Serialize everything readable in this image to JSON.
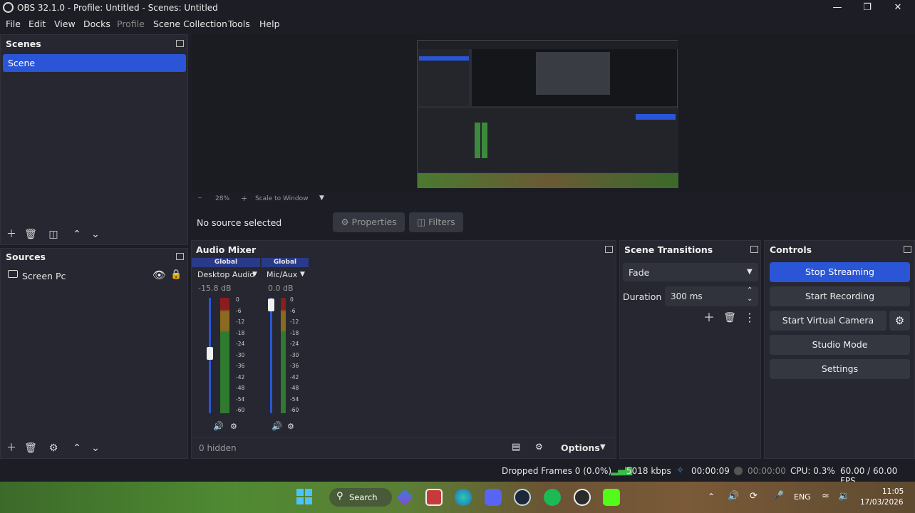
{
  "window": {
    "title": "OBS 32.1.0 - Profile: Untitled - Scenes: Untitled"
  },
  "menu": [
    "File",
    "Edit",
    "View",
    "Docks",
    "Profile",
    "Scene Collection",
    "Tools",
    "Help"
  ],
  "scenes": {
    "title": "Scenes",
    "items": [
      "Scene"
    ]
  },
  "preview": {
    "zoom": "28%",
    "scale_mode": "Scale to Window"
  },
  "source_bar": {
    "status": "No source selected",
    "properties": "Properties",
    "filters": "Filters"
  },
  "sources": {
    "title": "Sources",
    "items": [
      "Screen Pc"
    ]
  },
  "audio_mixer": {
    "title": "Audio Mixer",
    "channels": [
      {
        "badge": "Global",
        "name": "Desktop Audio",
        "db": "-15.8 dB",
        "fader": 0.55,
        "level": 0.95
      },
      {
        "badge": "Global",
        "name": "Mic/Aux",
        "db": "0.0 dB",
        "fader": 0.95,
        "level": 0.95
      }
    ],
    "scale": [
      "0",
      "-6",
      "-12",
      "-18",
      "-24",
      "-30",
      "-36",
      "-42",
      "-48",
      "-54",
      "-60"
    ],
    "hidden": "0 hidden",
    "options": "Options"
  },
  "scene_transitions": {
    "title": "Scene Transitions",
    "type": "Fade",
    "duration_label": "Duration",
    "duration_value": "300 ms"
  },
  "controls": {
    "title": "Controls",
    "stop_streaming": "Stop Streaming",
    "start_recording": "Start Recording",
    "start_virtual_camera": "Start Virtual Camera",
    "studio_mode": "Studio Mode",
    "settings": "Settings"
  },
  "status": {
    "dropped_frames": "Dropped Frames 0 (0.0%)",
    "bitrate": "5018 kbps",
    "stream_time": "00:00:09",
    "record_time": "00:00:00",
    "cpu": "CPU: 0.3%",
    "fps": "60.00 / 60.00 FPS"
  },
  "taskbar": {
    "search": "Search",
    "lang": "ENG",
    "time": "11:05",
    "date": "17/03/2026"
  },
  "colors": {
    "accent": "#2a55d6",
    "panel": "#262730",
    "background": "#1d1e25"
  }
}
